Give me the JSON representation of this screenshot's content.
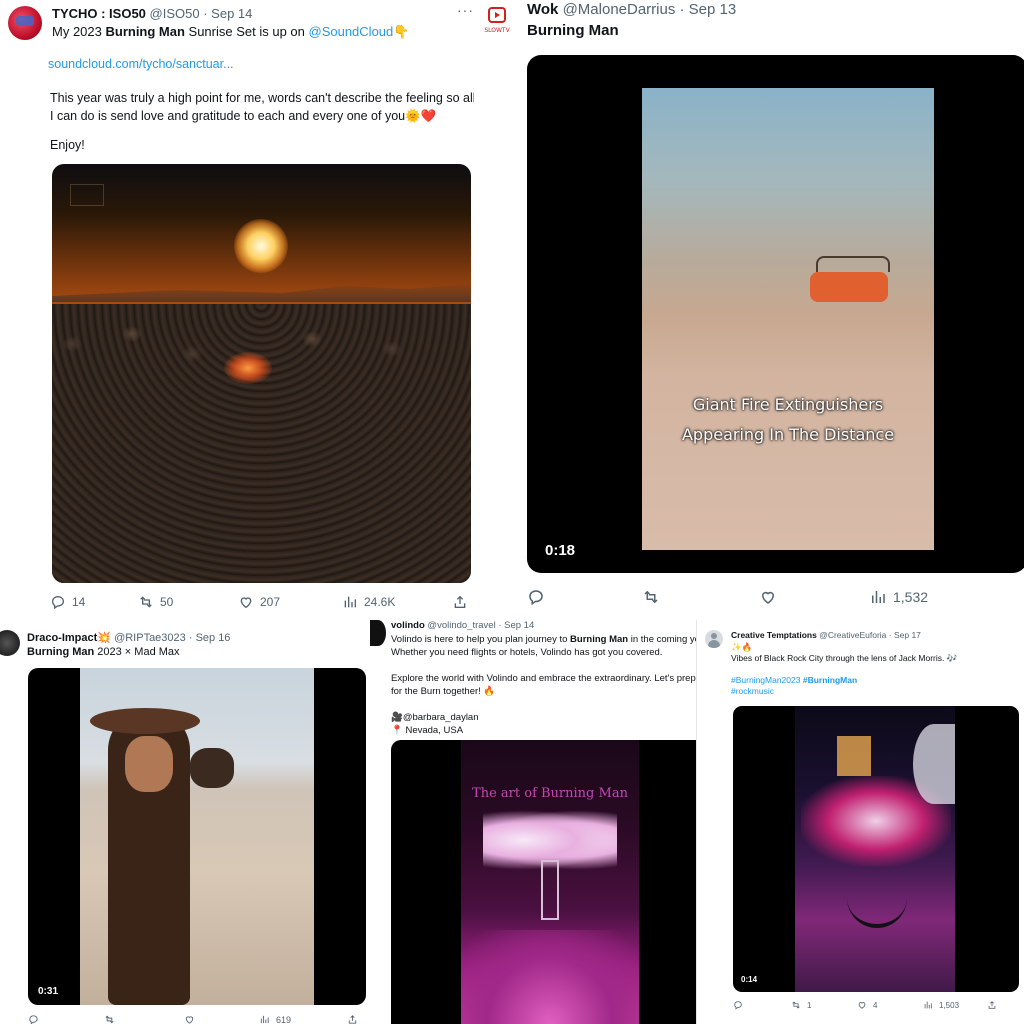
{
  "tweets": [
    {
      "author": "TYCHO : ISO50",
      "handle": "@ISO50",
      "date": "· Sep 14",
      "text_pre": "My 2023 ",
      "text_bold": "Burning Man",
      "text_post": " Sunrise Set is up on ",
      "mention": "@SoundCloud",
      "mention_emoji": "👇",
      "link": "soundcloud.com/tycho/sanctuar...",
      "paragraph": "This year was truly a high point for me, words can't describe the feeling so all I can do is send love and gratitude to each and every one of you",
      "paragraph_emoji": "🌞❤️",
      "closing": "Enjoy!",
      "replies": "14",
      "retweets": "50",
      "likes": "207",
      "views": "24.6K"
    },
    {
      "author": "Wok",
      "handle": "@MaloneDarrius",
      "date": "· Sep 13",
      "text": "Burning Man",
      "caption_line1": "Giant Fire Extinguishers",
      "caption_line2": "Appearing In The Distance",
      "duration": "0:18",
      "views": "1,532",
      "avatar_label": "SLOWTV"
    },
    {
      "author": "Draco-Impact",
      "author_emoji": "💥",
      "handle": "@RIPTae3023",
      "date": "· Sep 16",
      "text_bold": "Burning Man",
      "text_post": " 2023 × Mad Max",
      "duration": "0:31",
      "views": "619"
    },
    {
      "author": "volindo",
      "handle": "@volindo_travel",
      "date": "· Sep 14",
      "line1_pre": "Volindo is here to help you plan journey to ",
      "line1_bold": "Burning Man",
      "line1_post": " in the coming year",
      "line2": "Whether you need flights or hotels, Volindo has got you covered.",
      "line3": "Explore the world with Volindo and embrace the extraordinary. Let's prepar",
      "line4": "for the Burn together!",
      "line4_emoji": "🔥",
      "credit": "🎥@barbara_daylan",
      "location": "📍 Nevada, USA",
      "video_title": "The art of Burning Man"
    },
    {
      "author": "Creative Temptations",
      "handle": "@CreativeEuforia",
      "date": "· Sep 17",
      "emojis": "✨🔥",
      "text": "Vibes of Black Rock City through the lens of Jack Morris.",
      "text_emoji": "🎶",
      "hashtag1": "#BurningMan2023",
      "hashtag2": "#BurningMan",
      "hashtag3": "#rockmusic",
      "duration": "0:14",
      "retweets": "1",
      "likes": "4",
      "views": "1,503"
    }
  ],
  "colors": {
    "link": "#1d9bf0",
    "muted": "#536471",
    "sunset": "#f07a1e",
    "neon_pink": "#c020a0"
  }
}
